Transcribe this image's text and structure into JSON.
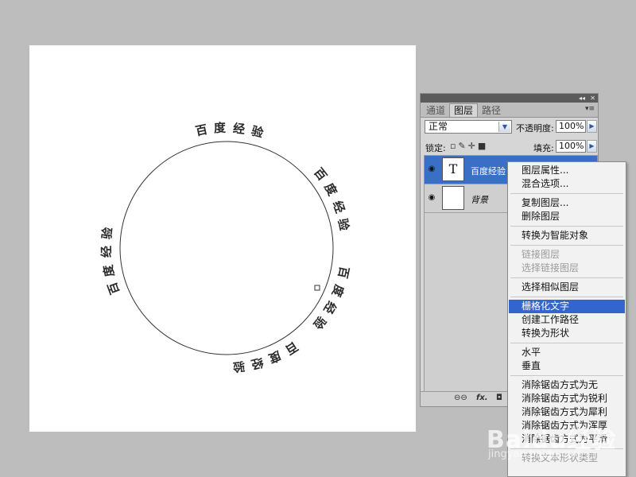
{
  "canvas": {
    "arc_texts": [
      "百度经验",
      "百度经验",
      "百度经验",
      "百度经验",
      "百度经验"
    ]
  },
  "panel": {
    "strip_buttons": [
      "◂◂",
      "✕"
    ],
    "tabs": [
      "通道",
      "图层",
      "路径"
    ],
    "active_tab": "图层",
    "menu_icon": "▾≡",
    "blend_mode": "正常",
    "opacity_label": "不透明度:",
    "opacity_value": "100%",
    "lock_label": "锁定:",
    "fill_label": "填充:",
    "fill_value": "100%",
    "layers": [
      {
        "name": "百度经验",
        "thumb": "T",
        "selected": true
      },
      {
        "name": "背景",
        "thumb": "",
        "selected": false
      }
    ],
    "bottom_icons": [
      "⊖⊖",
      "fx.",
      "◘"
    ]
  },
  "context_menu": {
    "items": [
      {
        "label": "图层属性...",
        "state": "normal"
      },
      {
        "label": "混合选项...",
        "state": "normal"
      },
      {
        "sep": true
      },
      {
        "label": "复制图层...",
        "state": "normal"
      },
      {
        "label": "删除图层",
        "state": "normal"
      },
      {
        "sep": true
      },
      {
        "label": "转换为智能对象",
        "state": "normal"
      },
      {
        "sep": true
      },
      {
        "label": "链接图层",
        "state": "disabled"
      },
      {
        "label": "选择链接图层",
        "state": "disabled"
      },
      {
        "sep": true
      },
      {
        "label": "选择相似图层",
        "state": "normal"
      },
      {
        "sep": true
      },
      {
        "label": "栅格化文字",
        "state": "highlighted"
      },
      {
        "label": "创建工作路径",
        "state": "normal"
      },
      {
        "label": "转换为形状",
        "state": "normal"
      },
      {
        "sep": true
      },
      {
        "label": "水平",
        "state": "normal"
      },
      {
        "label": "垂直",
        "state": "normal"
      },
      {
        "sep": true
      },
      {
        "label": "消除锯齿方式为无",
        "state": "normal"
      },
      {
        "label": "消除锯齿方式为锐利",
        "state": "normal"
      },
      {
        "label": "消除锯齿方式为犀利",
        "state": "normal"
      },
      {
        "label": "消除锯齿方式为浑厚",
        "state": "normal"
      },
      {
        "label": "消除锯齿方式为平滑",
        "state": "normal"
      },
      {
        "sep": true
      },
      {
        "label": "转换文本形状类型",
        "state": "disabled"
      }
    ]
  },
  "watermark": {
    "text": "Baidu经验",
    "sub": "jingyan.baidu.com"
  },
  "colors": {
    "highlight": "#3366cc",
    "selected_layer": "#3a6fc6",
    "workspace": "#bdbdbd"
  }
}
